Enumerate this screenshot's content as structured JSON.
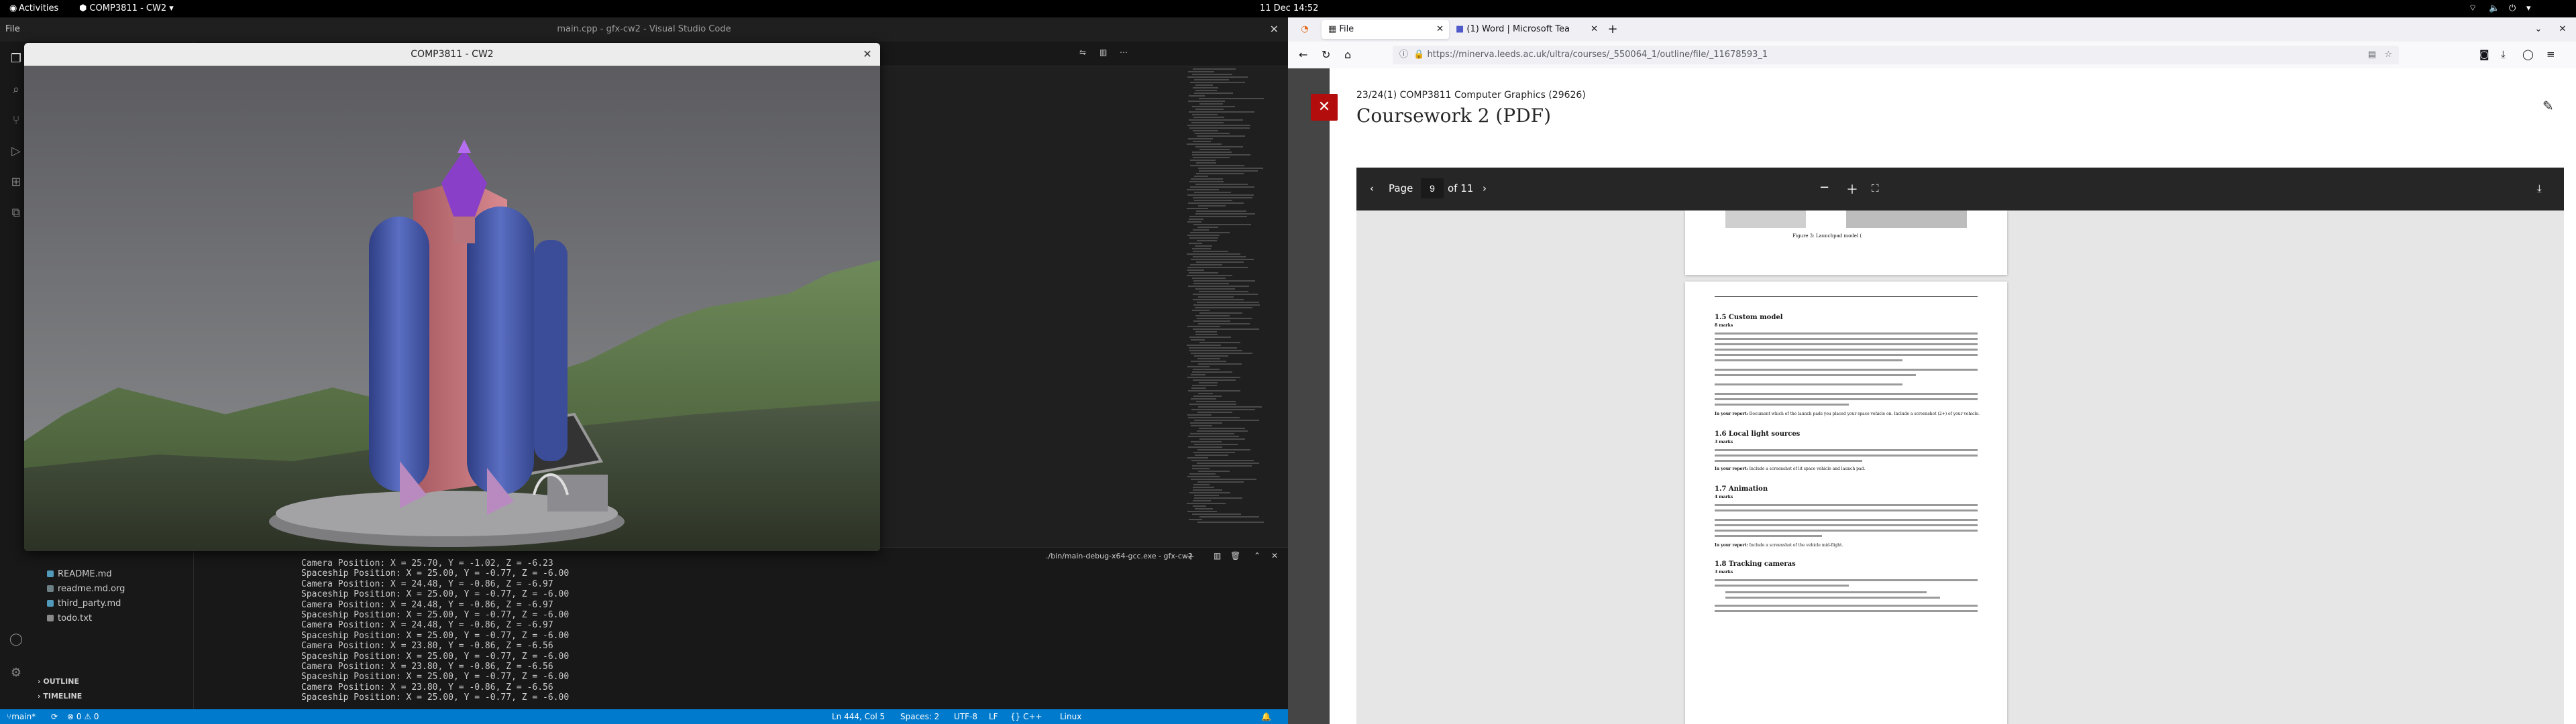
{
  "gnome": {
    "activities": "Activities",
    "app_name": "COMP3811 - CW2 ▾",
    "clock": "11 Dec  14:52",
    "indicators": "▾"
  },
  "vscode": {
    "window_title": "main.cpp - gfx-cw2 - Visual Studio Code",
    "menu_file": "File",
    "sidebar": {
      "files": [
        "README.md",
        "readme.md.org",
        "third_party.md",
        "todo.txt"
      ],
      "outline": "OUTLINE",
      "timeline": "TIMELINE"
    },
    "terminal": {
      "title": "./bin/main-debug-x64-gcc.exe - gfx-cw2",
      "lines": [
        "Camera Position: X = 25.70, Y = -1.02, Z = -6.23",
        "Spaceship Position: X = 25.00, Y = -0.77, Z = -6.00",
        "Camera Position: X = 24.48, Y = -0.86, Z = -6.97",
        "Spaceship Position: X = 25.00, Y = -0.77, Z = -6.00",
        "Camera Position: X = 24.48, Y = -0.86, Z = -6.97",
        "Spaceship Position: X = 25.00, Y = -0.77, Z = -6.00",
        "Camera Position: X = 24.48, Y = -0.86, Z = -6.97",
        "Spaceship Position: X = 25.00, Y = -0.77, Z = -6.00",
        "Camera Position: X = 23.80, Y = -0.86, Z = -6.56",
        "Spaceship Position: X = 25.00, Y = -0.77, Z = -6.00",
        "Camera Position: X = 23.80, Y = -0.86, Z = -6.56",
        "Spaceship Position: X = 25.00, Y = -0.77, Z = -6.00",
        "Camera Position: X = 23.80, Y = -0.86, Z = -6.56",
        "Spaceship Position: X = 25.00, Y = -0.77, Z = -6.00"
      ]
    },
    "status": {
      "branch": "main*",
      "sync": "⟳",
      "problems": "⊗ 0  ⚠ 0",
      "position": "Ln 444, Col 5",
      "spaces": "Spaces: 2",
      "encoding": "UTF-8",
      "eol": "LF",
      "language": "{} C++",
      "os": "Linux"
    }
  },
  "glwindow": {
    "title": "COMP3811 - CW2"
  },
  "firefox": {
    "tabs": [
      {
        "label": "File",
        "active": true
      },
      {
        "label": "(1) Word | Microsoft Tea",
        "active": false
      }
    ],
    "url": "https://minerva.leeds.ac.uk/ultra/courses/_550064_1/outline/file/_11678593_1",
    "course": "23/24(1) COMP3811 Computer Graphics (29626)",
    "doc_title": "Coursework 2 (PDF)",
    "pdf": {
      "page_label": "Page",
      "page_current": "9",
      "page_total": "of 11",
      "figure_caption": "Figure 3: Launchpad model (",
      "sections": [
        {
          "heading": "1.5   Custom model",
          "marks": "8 marks"
        },
        {
          "heading": "1.6   Local light sources",
          "marks": "3 marks"
        },
        {
          "heading": "1.7   Animation",
          "marks": "4 marks"
        },
        {
          "heading": "1.8   Tracking cameras",
          "marks": "3 marks"
        }
      ],
      "in_report": "In your report:",
      "report_notes": [
        "Document which of the launch pads you placed your space vehicle on. Include a screenshot (2+) of your vehicle.",
        "Include a screenshot of lit space vehicle and launch pad.",
        "Include a screenshot of the vehicle mid-flight."
      ]
    }
  },
  "colors": {
    "vscode_accent": "#007acc",
    "blackboard_red": "#b40d0d",
    "rocket_blue": "#4a5fb0",
    "rocket_pink": "#d07880",
    "rocket_purple": "#8a3fc8"
  }
}
